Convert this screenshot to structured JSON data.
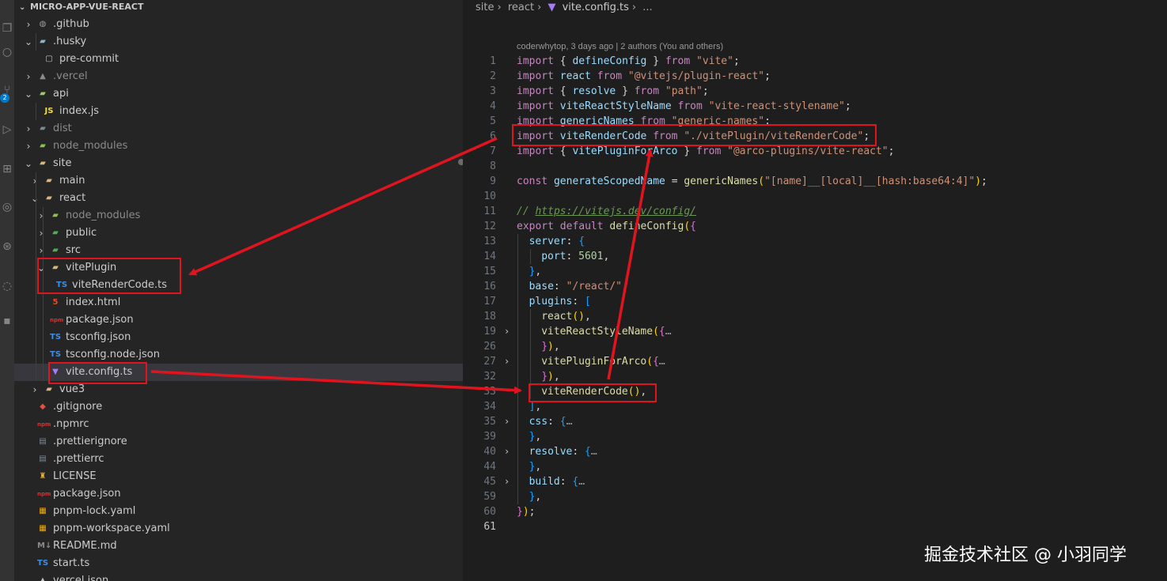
{
  "explorer": {
    "root": "MICRO-APP-VUE-REACT",
    "items": [
      {
        "label": ".github",
        "icon": "github-folder-icon",
        "glyph": "◍",
        "color": "#9aa0a6",
        "chevron": "›",
        "depth": 1,
        "dim": false
      },
      {
        "label": ".husky",
        "icon": "husky-folder-icon",
        "glyph": "▰",
        "color": "#8ab4c8",
        "chevron": "⌄",
        "depth": 1,
        "dim": false
      },
      {
        "label": "pre-commit",
        "icon": "file-icon",
        "glyph": "▢",
        "color": "#c5c5c5",
        "chevron": "",
        "depth": 2,
        "dim": false
      },
      {
        "label": ".vercel",
        "icon": "vercel-folder-icon",
        "glyph": "▲",
        "color": "#8b8b8b",
        "chevron": "›",
        "depth": 1,
        "dim": true
      },
      {
        "label": "api",
        "icon": "api-folder-icon",
        "glyph": "▰",
        "color": "#9ccc65",
        "chevron": "⌄",
        "depth": 1,
        "dim": false
      },
      {
        "label": "index.js",
        "icon": "javascript-file-icon",
        "glyph": "JS",
        "color": "#f1dd3f",
        "chevron": "",
        "depth": 2,
        "dim": false
      },
      {
        "label": "dist",
        "icon": "dist-folder-icon",
        "glyph": "▰",
        "color": "#7b8a8f",
        "chevron": "›",
        "depth": 1,
        "dim": true
      },
      {
        "label": "node_modules",
        "icon": "node-modules-folder-icon",
        "glyph": "▰",
        "color": "#8bc34a",
        "chevron": "›",
        "depth": 1,
        "dim": true
      },
      {
        "label": "site",
        "icon": "folder-open-icon",
        "glyph": "▰",
        "color": "#dcb67a",
        "chevron": "⌄",
        "depth": 1,
        "dim": false
      },
      {
        "label": "main",
        "icon": "folder-icon",
        "glyph": "▰",
        "color": "#dcb67a",
        "chevron": "›",
        "depth": 2,
        "dim": false
      },
      {
        "label": "react",
        "icon": "folder-open-icon",
        "glyph": "▰",
        "color": "#dcb67a",
        "chevron": "⌄",
        "depth": 2,
        "dim": false
      },
      {
        "label": "node_modules",
        "icon": "node-modules-folder-icon",
        "glyph": "▰",
        "color": "#8bc34a",
        "chevron": "›",
        "depth": 3,
        "dim": true
      },
      {
        "label": "public",
        "icon": "public-folder-icon",
        "glyph": "▰",
        "color": "#4caf50",
        "chevron": "›",
        "depth": 3,
        "dim": false
      },
      {
        "label": "src",
        "icon": "src-folder-icon",
        "glyph": "▰",
        "color": "#4caf50",
        "chevron": "›",
        "depth": 3,
        "dim": false
      },
      {
        "label": "vitePlugin",
        "icon": "folder-open-icon",
        "glyph": "▰",
        "color": "#dcb67a",
        "chevron": "⌄",
        "depth": 3,
        "dim": false
      },
      {
        "label": "viteRenderCode.ts",
        "icon": "typescript-file-icon",
        "glyph": "TS",
        "color": "#3b8eea",
        "chevron": "",
        "depth": 4,
        "dim": false
      },
      {
        "label": "index.html",
        "icon": "html-file-icon",
        "glyph": "5",
        "color": "#e44d26",
        "chevron": "",
        "depth": 3,
        "dim": false
      },
      {
        "label": "package.json",
        "icon": "npm-file-icon",
        "glyph": "npm",
        "color": "#cb3837",
        "chevron": "",
        "depth": 3,
        "dim": false
      },
      {
        "label": "tsconfig.json",
        "icon": "tsconfig-file-icon",
        "glyph": "TS",
        "color": "#3b8eea",
        "chevron": "",
        "depth": 3,
        "dim": false
      },
      {
        "label": "tsconfig.node.json",
        "icon": "tsconfig-file-icon",
        "glyph": "TS",
        "color": "#3b8eea",
        "chevron": "",
        "depth": 3,
        "dim": false
      },
      {
        "label": "vite.config.ts",
        "icon": "vite-file-icon",
        "glyph": "▼",
        "color": "#a77cf7",
        "chevron": "",
        "depth": 3,
        "dim": false,
        "selected": true
      },
      {
        "label": "vue3",
        "icon": "folder-icon",
        "glyph": "▰",
        "color": "#dcb67a",
        "chevron": "›",
        "depth": 2,
        "dim": false
      },
      {
        "label": ".gitignore",
        "icon": "git-file-icon",
        "glyph": "◆",
        "color": "#e0533c",
        "chevron": "",
        "depth": 1,
        "dim": false
      },
      {
        "label": ".npmrc",
        "icon": "npm-file-icon",
        "glyph": "npm",
        "color": "#cb3837",
        "chevron": "",
        "depth": 1,
        "dim": false
      },
      {
        "label": ".prettierignore",
        "icon": "prettier-file-icon",
        "glyph": "▤",
        "color": "#7c8a9a",
        "chevron": "",
        "depth": 1,
        "dim": false
      },
      {
        "label": ".prettierrc",
        "icon": "prettier-file-icon",
        "glyph": "▤",
        "color": "#7c8a9a",
        "chevron": "",
        "depth": 1,
        "dim": false
      },
      {
        "label": "LICENSE",
        "icon": "license-file-icon",
        "glyph": "♜",
        "color": "#e5b54a",
        "chevron": "",
        "depth": 1,
        "dim": false
      },
      {
        "label": "package.json",
        "icon": "npm-file-icon",
        "glyph": "npm",
        "color": "#cb3837",
        "chevron": "",
        "depth": 1,
        "dim": false
      },
      {
        "label": "pnpm-lock.yaml",
        "icon": "pnpm-file-icon",
        "glyph": "▦",
        "color": "#f9ad00",
        "chevron": "",
        "depth": 1,
        "dim": false
      },
      {
        "label": "pnpm-workspace.yaml",
        "icon": "pnpm-file-icon",
        "glyph": "▦",
        "color": "#f9ad00",
        "chevron": "",
        "depth": 1,
        "dim": false
      },
      {
        "label": "README.md",
        "icon": "markdown-file-icon",
        "glyph": "M↓",
        "color": "#8b8b8b",
        "chevron": "",
        "depth": 1,
        "dim": false
      },
      {
        "label": "start.ts",
        "icon": "typescript-file-icon",
        "glyph": "TS",
        "color": "#3b8eea",
        "chevron": "",
        "depth": 1,
        "dim": false
      },
      {
        "label": "vercel.json",
        "icon": "vercel-file-icon",
        "glyph": "▲",
        "color": "#c5c5c5",
        "chevron": "",
        "depth": 1,
        "dim": false
      }
    ]
  },
  "breadcrumb": {
    "parts": [
      "site",
      "react"
    ],
    "file": "vite.config.ts",
    "ellipsis": "..."
  },
  "blame": "coderwhytop, 3 days ago | 2 authors (You and others)",
  "code_lines": [
    {
      "n": "1",
      "fold": "",
      "indent": 0,
      "tokens": [
        [
          "kw",
          "import"
        ],
        [
          "pu",
          " { "
        ],
        [
          "va",
          "defineConfig"
        ],
        [
          "pu",
          " } "
        ],
        [
          "kw",
          "from"
        ],
        [
          "st",
          " \"vite\""
        ],
        [
          "pu",
          ";"
        ]
      ]
    },
    {
      "n": "2",
      "fold": "",
      "indent": 0,
      "tokens": [
        [
          "kw",
          "import"
        ],
        [
          "va",
          " react "
        ],
        [
          "kw",
          "from"
        ],
        [
          "st",
          " \"@vitejs/plugin-react\""
        ],
        [
          "pu",
          ";"
        ]
      ]
    },
    {
      "n": "3",
      "fold": "",
      "indent": 0,
      "tokens": [
        [
          "kw",
          "import"
        ],
        [
          "pu",
          " { "
        ],
        [
          "va",
          "resolve"
        ],
        [
          "pu",
          " } "
        ],
        [
          "kw",
          "from"
        ],
        [
          "st",
          " \"path\""
        ],
        [
          "pu",
          ";"
        ]
      ]
    },
    {
      "n": "4",
      "fold": "",
      "indent": 0,
      "tokens": [
        [
          "kw",
          "import"
        ],
        [
          "va",
          " viteReactStyleName "
        ],
        [
          "kw",
          "from"
        ],
        [
          "st",
          " \"vite-react-stylename\""
        ],
        [
          "pu",
          ";"
        ]
      ]
    },
    {
      "n": "5",
      "fold": "",
      "indent": 0,
      "tokens": [
        [
          "kw",
          "import"
        ],
        [
          "va",
          " genericNames "
        ],
        [
          "kw",
          "from"
        ],
        [
          "st",
          " \"generic-names\""
        ],
        [
          "pu",
          ";"
        ]
      ]
    },
    {
      "n": "6",
      "fold": "",
      "indent": 0,
      "tokens": [
        [
          "kw",
          "import"
        ],
        [
          "va",
          " viteRenderCode "
        ],
        [
          "kw",
          "from"
        ],
        [
          "st",
          " \"./vitePlugin/viteRenderCode\""
        ],
        [
          "pu",
          ";"
        ]
      ]
    },
    {
      "n": "7",
      "fold": "",
      "indent": 0,
      "tokens": [
        [
          "kw",
          "import"
        ],
        [
          "pu",
          " { "
        ],
        [
          "va",
          "vitePluginForArco"
        ],
        [
          "pu",
          " } "
        ],
        [
          "kw",
          "from"
        ],
        [
          "st",
          " \"@arco-plugins/vite-react\""
        ],
        [
          "pu",
          ";"
        ]
      ]
    },
    {
      "n": "8",
      "fold": "",
      "indent": 0,
      "tokens": []
    },
    {
      "n": "9",
      "fold": "",
      "indent": 0,
      "tokens": [
        [
          "kw",
          "const"
        ],
        [
          "va",
          " generateScopedName "
        ],
        [
          "pu",
          "= "
        ],
        [
          "fn",
          "genericNames"
        ],
        [
          "br1",
          "("
        ],
        [
          "st",
          "\"[name]__[local]__[hash:base64:4]\""
        ],
        [
          "br1",
          ")"
        ],
        [
          "pu",
          ";"
        ]
      ]
    },
    {
      "n": "10",
      "fold": "",
      "indent": 0,
      "tokens": []
    },
    {
      "n": "11",
      "fold": "",
      "indent": 0,
      "tokens": [
        [
          "cm",
          "// "
        ],
        [
          "cmu",
          "https://vitejs.dev/config/"
        ]
      ]
    },
    {
      "n": "12",
      "fold": "",
      "indent": 0,
      "tokens": [
        [
          "kw",
          "export"
        ],
        [
          "kw",
          " default"
        ],
        [
          "fn",
          " defineConfig"
        ],
        [
          "br1",
          "("
        ],
        [
          "br2",
          "{"
        ]
      ]
    },
    {
      "n": "13",
      "fold": "",
      "indent": 1,
      "tokens": [
        [
          "va",
          "server"
        ],
        [
          "pu",
          ": "
        ],
        [
          "br3",
          "{"
        ]
      ]
    },
    {
      "n": "14",
      "fold": "",
      "indent": 2,
      "tokens": [
        [
          "va",
          "port"
        ],
        [
          "pu",
          ": "
        ],
        [
          "nu",
          "5601"
        ],
        [
          "pu",
          ","
        ]
      ]
    },
    {
      "n": "15",
      "fold": "",
      "indent": 1,
      "tokens": [
        [
          "br3",
          "}"
        ],
        [
          "pu",
          ","
        ]
      ]
    },
    {
      "n": "16",
      "fold": "",
      "indent": 1,
      "tokens": [
        [
          "va",
          "base"
        ],
        [
          "pu",
          ": "
        ],
        [
          "st",
          "\"/react/\""
        ],
        [
          "pu",
          ","
        ]
      ]
    },
    {
      "n": "17",
      "fold": "",
      "indent": 1,
      "tokens": [
        [
          "va",
          "plugins"
        ],
        [
          "pu",
          ": "
        ],
        [
          "br3",
          "["
        ]
      ]
    },
    {
      "n": "18",
      "fold": "",
      "indent": 2,
      "tokens": [
        [
          "fn",
          "react"
        ],
        [
          "br1",
          "()"
        ],
        [
          "pu",
          ","
        ]
      ]
    },
    {
      "n": "19",
      "fold": "›",
      "indent": 2,
      "tokens": [
        [
          "fn",
          "viteReactStyleName"
        ],
        [
          "br1",
          "("
        ],
        [
          "br2",
          "{"
        ],
        [
          "ell",
          "…"
        ]
      ]
    },
    {
      "n": "26",
      "fold": "",
      "indent": 2,
      "tokens": [
        [
          "br2",
          "}"
        ],
        [
          "br1",
          ")"
        ],
        [
          "pu",
          ","
        ]
      ]
    },
    {
      "n": "27",
      "fold": "›",
      "indent": 2,
      "tokens": [
        [
          "fn",
          "vitePluginForArco"
        ],
        [
          "br1",
          "("
        ],
        [
          "br2",
          "{"
        ],
        [
          "ell",
          "…"
        ]
      ]
    },
    {
      "n": "32",
      "fold": "",
      "indent": 2,
      "tokens": [
        [
          "br2",
          "}"
        ],
        [
          "br1",
          ")"
        ],
        [
          "pu",
          ","
        ]
      ]
    },
    {
      "n": "33",
      "fold": "",
      "indent": 2,
      "tokens": [
        [
          "fn",
          "viteRenderCode"
        ],
        [
          "br1",
          "()"
        ],
        [
          "pu",
          ","
        ]
      ]
    },
    {
      "n": "34",
      "fold": "",
      "indent": 1,
      "tokens": [
        [
          "br3",
          "]"
        ],
        [
          "pu",
          ","
        ]
      ]
    },
    {
      "n": "35",
      "fold": "›",
      "indent": 1,
      "tokens": [
        [
          "va",
          "css"
        ],
        [
          "pu",
          ": "
        ],
        [
          "br3",
          "{"
        ],
        [
          "ell",
          "…"
        ]
      ]
    },
    {
      "n": "39",
      "fold": "",
      "indent": 1,
      "tokens": [
        [
          "br3",
          "}"
        ],
        [
          "pu",
          ","
        ]
      ]
    },
    {
      "n": "40",
      "fold": "›",
      "indent": 1,
      "tokens": [
        [
          "va",
          "resolve"
        ],
        [
          "pu",
          ": "
        ],
        [
          "br3",
          "{"
        ],
        [
          "ell",
          "…"
        ]
      ]
    },
    {
      "n": "44",
      "fold": "",
      "indent": 1,
      "tokens": [
        [
          "br3",
          "}"
        ],
        [
          "pu",
          ","
        ]
      ]
    },
    {
      "n": "45",
      "fold": "›",
      "indent": 1,
      "tokens": [
        [
          "va",
          "build"
        ],
        [
          "pu",
          ": "
        ],
        [
          "br3",
          "{"
        ],
        [
          "ell",
          "…"
        ]
      ]
    },
    {
      "n": "59",
      "fold": "",
      "indent": 1,
      "tokens": [
        [
          "br3",
          "}"
        ],
        [
          "pu",
          ","
        ]
      ]
    },
    {
      "n": "60",
      "fold": "",
      "indent": 0,
      "tokens": [
        [
          "br2",
          "}"
        ],
        [
          "br1",
          ")"
        ],
        [
          "pu",
          ";"
        ]
      ]
    },
    {
      "n": "61",
      "fold": "",
      "indent": 0,
      "tokens": [],
      "current": true
    }
  ],
  "watermark": "掘金技术社区 @ 小羽同学",
  "colors": {
    "annotation": "#e0141e",
    "selection": "#37373d"
  }
}
